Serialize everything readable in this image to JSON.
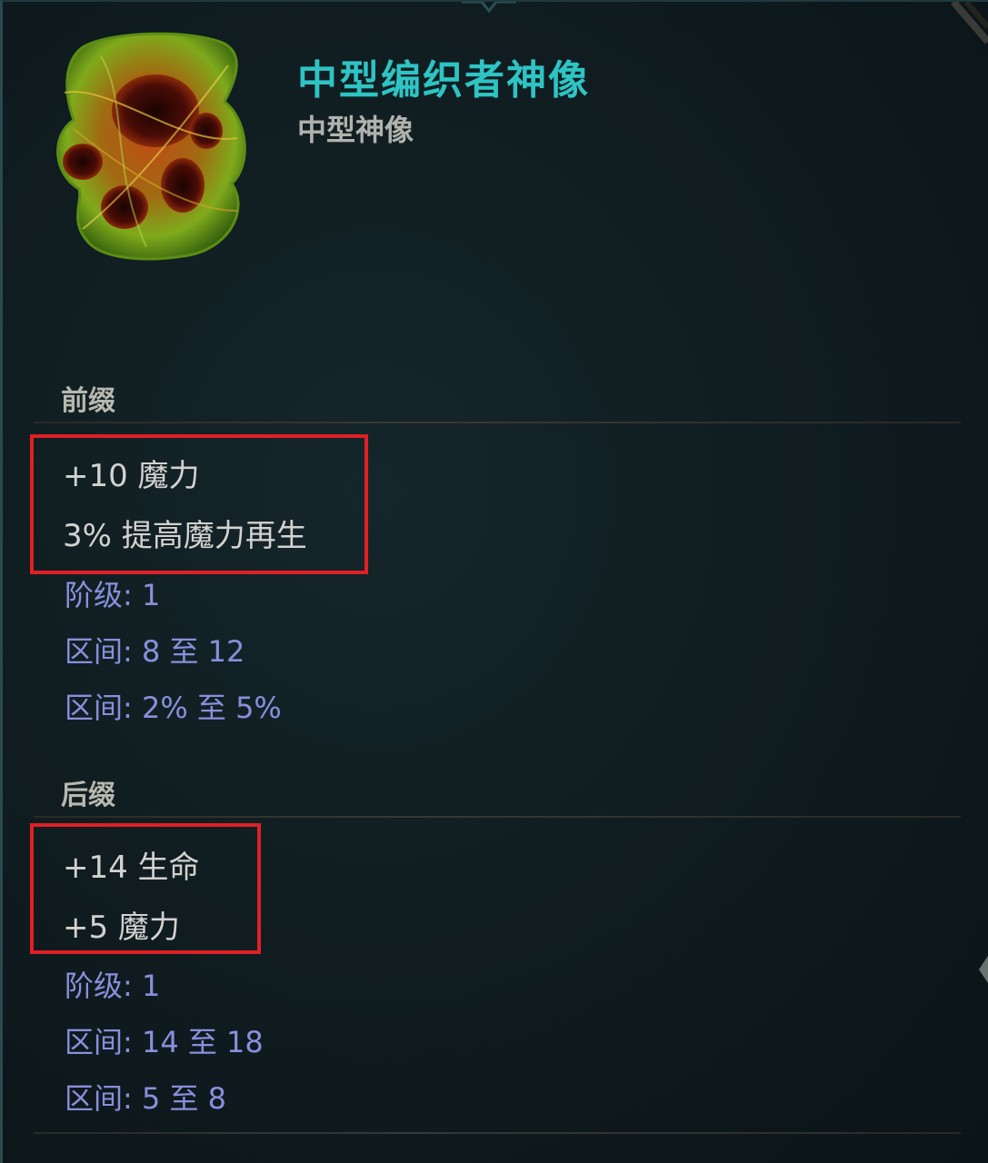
{
  "item": {
    "title": "中型编织者神像",
    "subtitle": "中型神像",
    "icon": "idol-icon"
  },
  "colors": {
    "title": "#2ec4c4",
    "affix": "#d2d2cf",
    "meta": "#8a8fdc",
    "highlight_box": "#e01f26",
    "background": "#0c1519"
  },
  "prefix": {
    "header": "前缀",
    "mods": [
      "+10 魔力",
      "3% 提高魔力再生"
    ],
    "tier": "阶级: 1",
    "ranges": [
      "区间: 8 至 12",
      "区间: 2% 至 5%"
    ]
  },
  "suffix": {
    "header": "后缀",
    "mods": [
      "+14 生命",
      "+5 魔力"
    ],
    "tier": "阶级: 1",
    "ranges": [
      "区间: 14 至 18",
      "区间: 5 至 8"
    ]
  }
}
